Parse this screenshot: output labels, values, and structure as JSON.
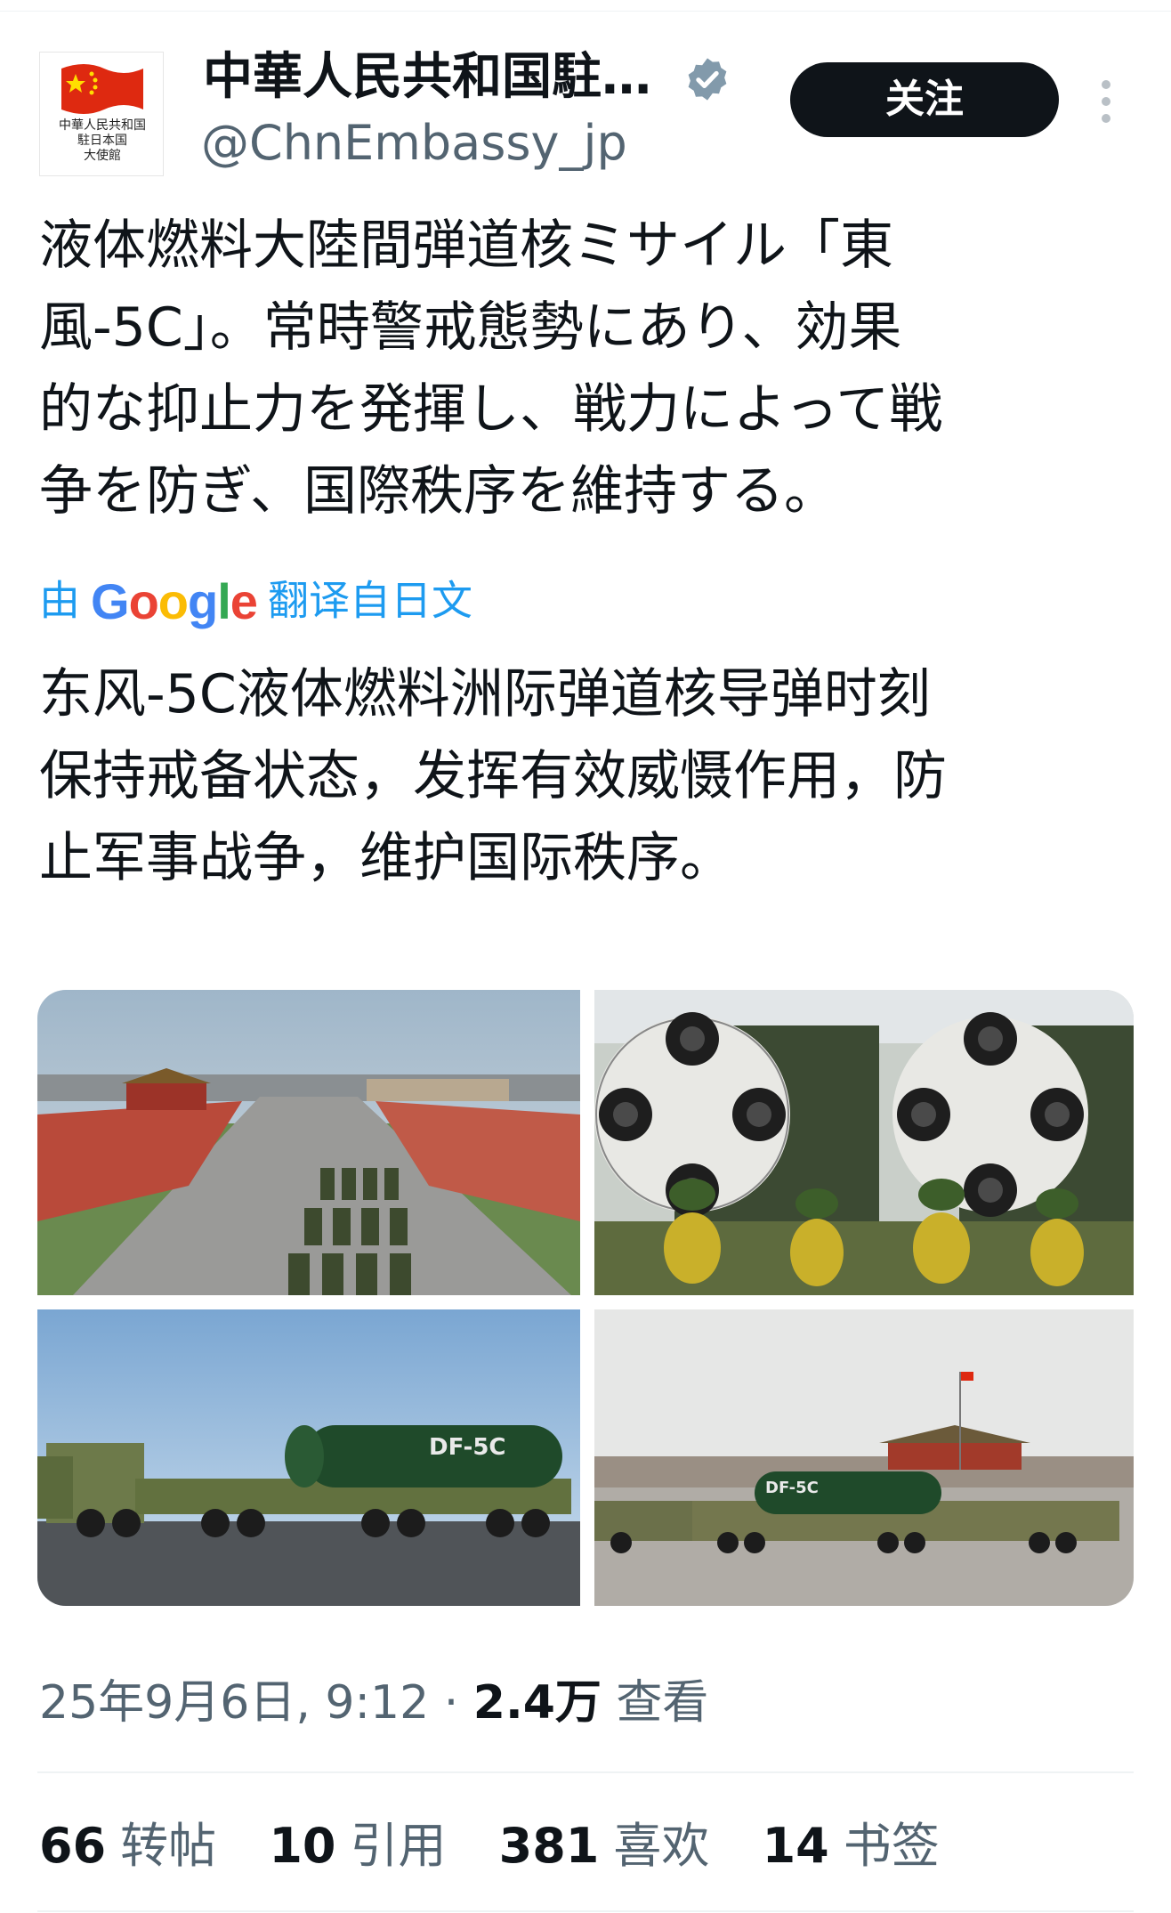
{
  "author": {
    "display_name": "中華人民共和国駐…",
    "handle": "@ChnEmbassy_jp",
    "avatar_caption": [
      "中華人民共和国",
      "駐日本国",
      "大使館"
    ],
    "verified": true,
    "verified_icon": "verified-badge-icon"
  },
  "actions": {
    "follow_label": "关注",
    "more_icon": "more-vertical-icon"
  },
  "tweet": {
    "original_lines": [
      "液体燃料大陸間弾道核ミサイル「東",
      "風-5C」。常時警戒態勢にあり、効果",
      "的な抑止力を発揮し、戦力によって戦",
      "争を防ぎ、国際秩序を維持する。"
    ],
    "translate_prefix": "由",
    "translate_brand": "Google",
    "translate_suffix": "翻译自日文",
    "translated_lines": [
      "东风-5C液体燃料洲际弹道核导弹时刻",
      "保持戒备状态，发挥有效威慑作用，防",
      "止军事战争，维护国际秩序。"
    ]
  },
  "media": {
    "photo_3_label": "DF-5C",
    "photo_4_label": "DF-5C"
  },
  "meta": {
    "date": "25年9月6日, 9:12",
    "separator": "·",
    "views_count": "2.4万",
    "views_label": "查看"
  },
  "stats": {
    "reposts_count": "66",
    "reposts_label": "转帖",
    "quotes_count": "10",
    "quotes_label": "引用",
    "likes_count": "381",
    "likes_label": "喜欢",
    "bookmarks_count": "14",
    "bookmarks_label": "书签"
  },
  "colors": {
    "link_blue": "#1d9bf0",
    "secondary_text": "#536471",
    "primary_text": "#0f1419",
    "follow_button_bg": "#0f1419",
    "verified_badge": "#829aab",
    "flag_red": "#de2910",
    "flag_yellow": "#ffde00"
  }
}
